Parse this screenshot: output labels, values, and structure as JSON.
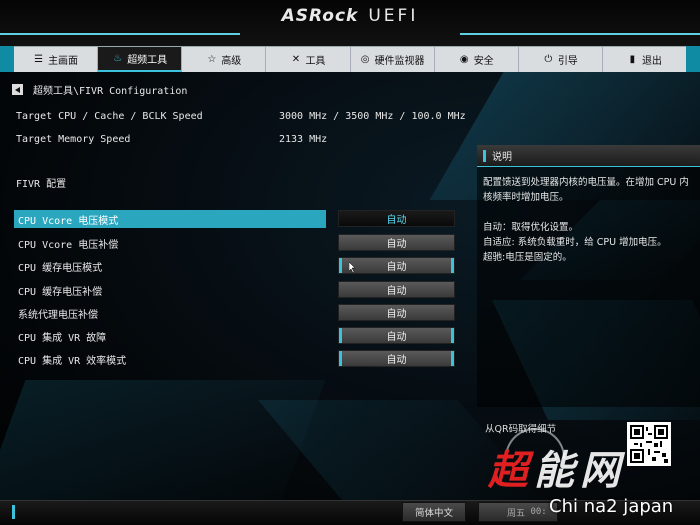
{
  "header": {
    "brand_a": "ASRock",
    "brand_b": "UEFI"
  },
  "nav": [
    {
      "label": "主画面",
      "icon": "menu-icon",
      "glyph": "☰"
    },
    {
      "label": "超频工具",
      "icon": "flame-icon",
      "glyph": "♨"
    },
    {
      "label": "高级",
      "icon": "star-icon",
      "glyph": "☆"
    },
    {
      "label": "工具",
      "icon": "tools-icon",
      "glyph": "✕"
    },
    {
      "label": "硬件监视器",
      "icon": "monitor-icon",
      "glyph": "◎"
    },
    {
      "label": "安全",
      "icon": "shield-icon",
      "glyph": "◉"
    },
    {
      "label": "引导",
      "icon": "power-icon",
      "glyph": "⏻"
    },
    {
      "label": "退出",
      "icon": "exit-icon",
      "glyph": "▮"
    }
  ],
  "breadcrumb": "超频工具\\FIVR Configuration",
  "info": [
    {
      "label": "Target CPU / Cache / BCLK Speed",
      "value": "3000 MHz / 3500 MHz / 100.0 MHz"
    },
    {
      "label": "Target Memory Speed",
      "value": "2133 MHz"
    }
  ],
  "section_title": "FIVR 配置",
  "settings": [
    {
      "label": "CPU Vcore 电压模式",
      "value": "自动"
    },
    {
      "label": "CPU Vcore 电压补偿",
      "value": "自动"
    },
    {
      "label": "CPU 缓存电压模式",
      "value": "自动"
    },
    {
      "label": "CPU 缓存电压补偿",
      "value": "自动"
    },
    {
      "label": "系统代理电压补偿",
      "value": "自动"
    },
    {
      "label": "CPU 集成 VR 故障",
      "value": "自动"
    },
    {
      "label": "CPU 集成 VR 效率模式",
      "value": "自动"
    }
  ],
  "description": {
    "title": "说明",
    "p1": "配置馈送到处理器内核的电压量。在增加 CPU 内核频率时增加电压。",
    "p2a": "自动：取得优化设置。",
    "p2b": "自适应: 系统负载重时，给 CPU 增加电压。",
    "p2c": "超驰:电压是固定的。"
  },
  "qr_label": "从QR码取得细节",
  "footer": {
    "language": "简体中文",
    "time_prefix": "周五",
    "time": "00:"
  },
  "watermark": {
    "logo_a": "超",
    "logo_b": "能网",
    "text": "Chi na2 japan"
  },
  "colors": {
    "accent": "#2aa6bf",
    "accent_light": "#5ad8ef"
  }
}
